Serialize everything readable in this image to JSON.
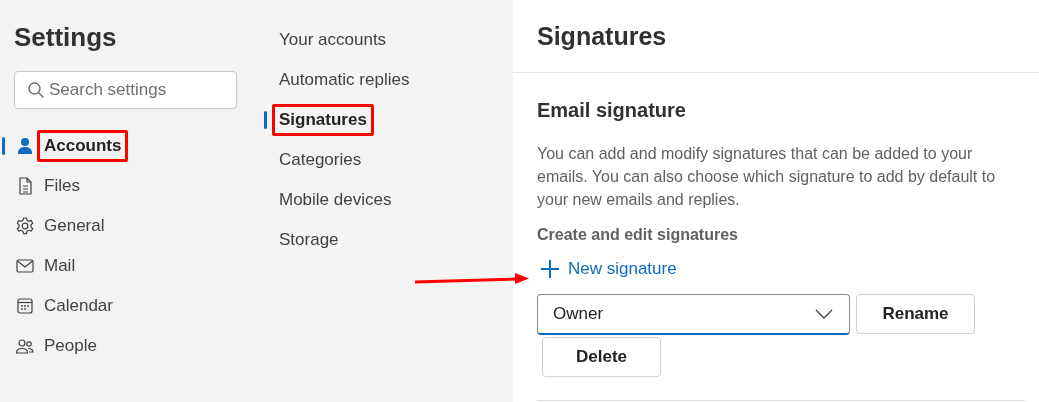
{
  "sidebar": {
    "title": "Settings",
    "search": {
      "placeholder": "Search settings"
    },
    "items": [
      {
        "label": "Accounts",
        "kind": "person",
        "selected": true,
        "highlighted": true
      },
      {
        "label": "Files",
        "kind": "file",
        "selected": false,
        "highlighted": false
      },
      {
        "label": "General",
        "kind": "gear",
        "selected": false,
        "highlighted": false
      },
      {
        "label": "Mail",
        "kind": "mail",
        "selected": false,
        "highlighted": false
      },
      {
        "label": "Calendar",
        "kind": "calendar",
        "selected": false,
        "highlighted": false
      },
      {
        "label": "People",
        "kind": "people",
        "selected": false,
        "highlighted": false
      }
    ]
  },
  "subnav": {
    "items": [
      {
        "label": "Your accounts",
        "selected": false,
        "highlighted": false
      },
      {
        "label": "Automatic replies",
        "selected": false,
        "highlighted": false
      },
      {
        "label": "Signatures",
        "selected": true,
        "highlighted": true
      },
      {
        "label": "Categories",
        "selected": false,
        "highlighted": false
      },
      {
        "label": "Mobile devices",
        "selected": false,
        "highlighted": false
      },
      {
        "label": "Storage",
        "selected": false,
        "highlighted": false
      }
    ]
  },
  "content": {
    "title": "Signatures",
    "section_title": "Email signature",
    "description": "You can add and modify signatures that can be added to your emails. You can also choose which signature to add by default to your new emails and replies.",
    "subheading": "Create and edit signatures",
    "new_button": "New signature",
    "signature_select": {
      "value": "Owner"
    },
    "buttons": [
      "Rename",
      "Delete"
    ]
  }
}
